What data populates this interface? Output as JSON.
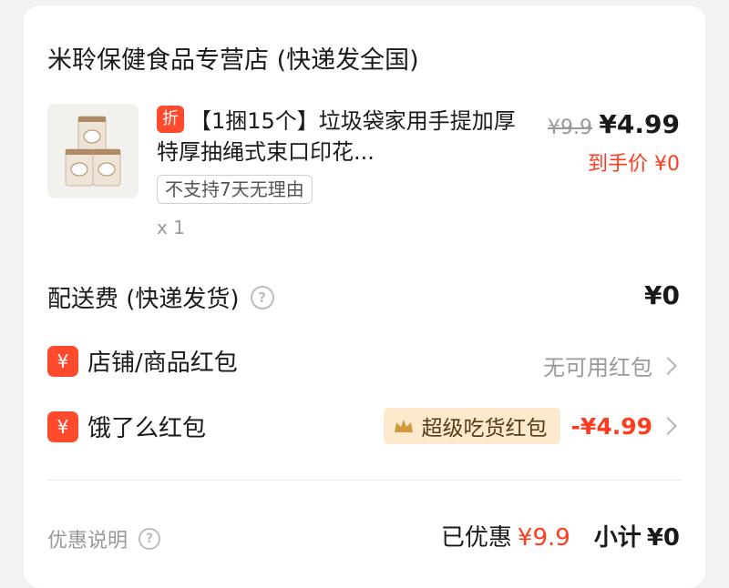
{
  "store": {
    "name": "米聆保健食品专营店 (快递发全国)"
  },
  "product": {
    "badge": "折",
    "title": "【1捆15个】垃圾袋家用手提加厚特厚抽绳式束口印花...",
    "tag": "不支持7天无理由",
    "quantity": "x 1",
    "original_price": "¥9.9",
    "current_price": "¥4.99",
    "final_price": "到手价 ¥0"
  },
  "shipping": {
    "label": "配送费 (快递发货)",
    "value": "¥0"
  },
  "store_coupon": {
    "icon": "¥",
    "label": "店铺/商品红包",
    "value": "无可用红包"
  },
  "eleme_coupon": {
    "icon": "¥",
    "label": "饿了么红包",
    "tag": "超级吃货红包",
    "value": "-¥4.99"
  },
  "footer": {
    "note": "优惠说明",
    "discounted_label": "已优惠",
    "discounted_value": "¥9.9",
    "subtotal_label": "小计",
    "subtotal_value": "¥0"
  },
  "colors": {
    "accent": "#ff4a2d",
    "price_red": "#ff3b1f",
    "gold_tag_bg": "#fde9cd"
  },
  "icons": [
    "product-thumbnail",
    "help-icon",
    "yuan-icon",
    "chevron-right-icon",
    "crown-icon"
  ]
}
